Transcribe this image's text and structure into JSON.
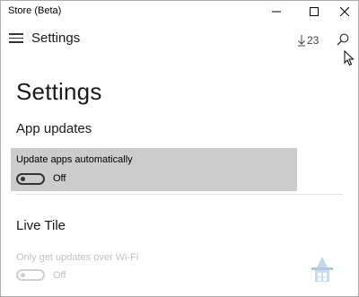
{
  "window": {
    "title": "Store (Beta)"
  },
  "header": {
    "title": "Settings",
    "downloads_count": "23"
  },
  "page": {
    "title": "Settings",
    "sections": [
      {
        "heading": "App updates",
        "settings": [
          {
            "label": "Update apps automatically",
            "state": "Off",
            "enabled": true
          }
        ]
      },
      {
        "heading": "Live Tile",
        "settings": [
          {
            "label": "Only get updates over Wi-Fi",
            "state": "Off",
            "enabled": false
          }
        ]
      }
    ]
  },
  "icons": {
    "menu": "hamburger-icon",
    "download": "download-arrow-icon",
    "search": "search-icon",
    "minimize": "minimize-icon",
    "maximize": "maximize-icon",
    "close": "close-icon",
    "logo": "windows-logo-watermark"
  },
  "colors": {
    "selected_setting_bg": "#cccccc",
    "disabled_text": "#c2c2c2",
    "toggle_off": "#333333"
  }
}
